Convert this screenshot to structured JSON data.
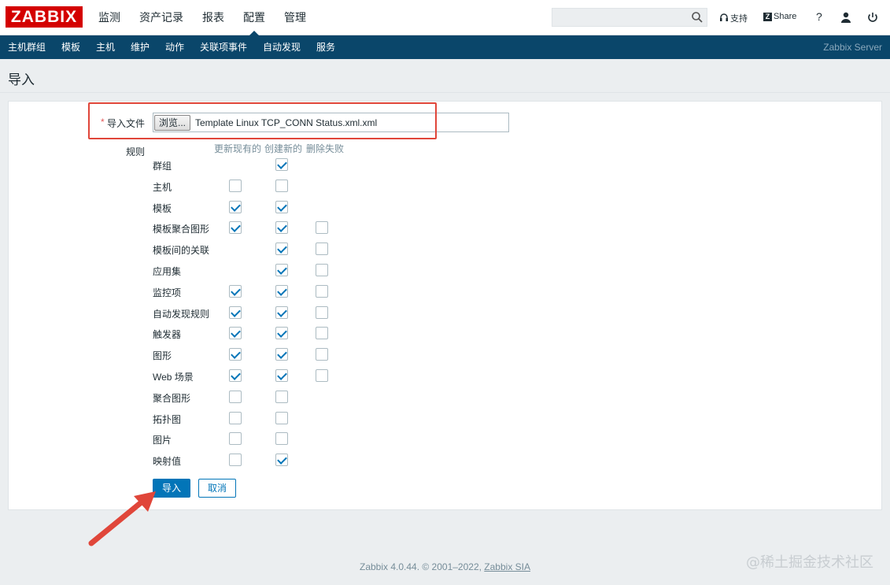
{
  "logo": "ZABBIX",
  "main_menu": [
    "监测",
    "资产记录",
    "报表",
    "配置",
    "管理"
  ],
  "search": {
    "value": ""
  },
  "top_links": {
    "support": "支持",
    "share": "Share",
    "help": "?"
  },
  "sub_menu": [
    "主机群组",
    "模板",
    "主机",
    "维护",
    "动作",
    "关联项事件",
    "自动发现",
    "服务"
  ],
  "server_name": "Zabbix Server",
  "page_title": "导入",
  "form": {
    "file_label": "导入文件",
    "required_mark": "*",
    "browse_label": "浏览...",
    "file_name": "Template Linux TCP_CONN Status.xml.xml",
    "rules_label": "规则",
    "col_update": "更新现有的",
    "col_create": "创建新的",
    "col_delete": "删除失败",
    "rules": [
      {
        "label": "群组",
        "update": null,
        "create": true,
        "delete": null
      },
      {
        "label": "主机",
        "update": false,
        "create": false,
        "delete": null
      },
      {
        "label": "模板",
        "update": true,
        "create": true,
        "delete": null
      },
      {
        "label": "模板聚合图形",
        "update": true,
        "create": true,
        "delete": false
      },
      {
        "label": "模板间的关联",
        "update": null,
        "create": true,
        "delete": false
      },
      {
        "label": "应用集",
        "update": null,
        "create": true,
        "delete": false
      },
      {
        "label": "监控项",
        "update": true,
        "create": true,
        "delete": false
      },
      {
        "label": "自动发现规则",
        "update": true,
        "create": true,
        "delete": false
      },
      {
        "label": "触发器",
        "update": true,
        "create": true,
        "delete": false
      },
      {
        "label": "图形",
        "update": true,
        "create": true,
        "delete": false
      },
      {
        "label": "Web 场景",
        "update": true,
        "create": true,
        "delete": false
      },
      {
        "label": "聚合图形",
        "update": false,
        "create": false,
        "delete": null
      },
      {
        "label": "拓扑图",
        "update": false,
        "create": false,
        "delete": null
      },
      {
        "label": "图片",
        "update": false,
        "create": false,
        "delete": null
      },
      {
        "label": "映射值",
        "update": false,
        "create": true,
        "delete": null
      }
    ],
    "import_label": "导入",
    "cancel_label": "取消"
  },
  "footer": {
    "text": "Zabbix 4.0.44. © 2001–2022, ",
    "link": "Zabbix SIA"
  },
  "watermark": "@稀土掘金技术社区",
  "colors": {
    "accent": "#0275b8",
    "nav_bg": "#0a466a",
    "logo_red": "#d40000",
    "highlight": "#e0463a"
  }
}
